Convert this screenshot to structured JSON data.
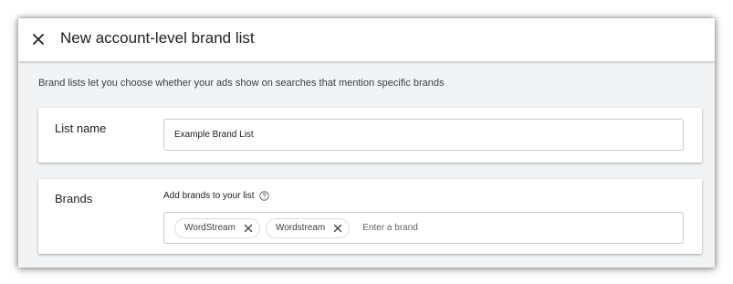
{
  "header": {
    "title": "New account-level brand list",
    "close_icon": "close-icon"
  },
  "description": "Brand lists let you choose whether your ads show on searches that mention specific brands",
  "list_name_card": {
    "label": "List name",
    "input_value": "Example Brand List"
  },
  "brands_card": {
    "label": "Brands",
    "field_label": "Add brands to your list",
    "help_icon": "help-circle-icon",
    "chips": [
      {
        "label": "WordStream"
      },
      {
        "label": "Wordstream"
      }
    ],
    "input_placeholder": "Enter a brand"
  },
  "colors": {
    "background": "#f1f3f4",
    "card": "#ffffff",
    "text": "#202124",
    "border": "#c8cbcf"
  }
}
